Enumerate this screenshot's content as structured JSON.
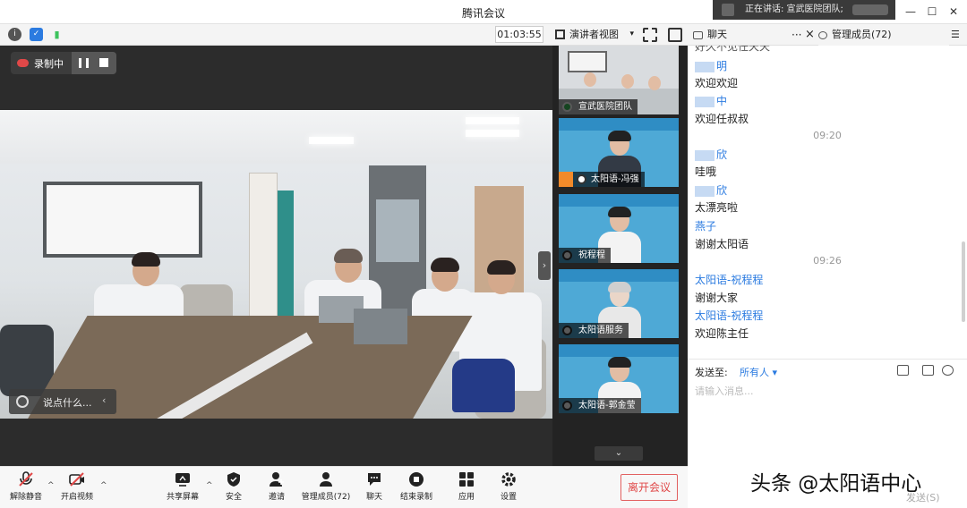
{
  "window": {
    "title": "腾讯会议",
    "speaking_label": "正在讲话: 宣武医院团队;"
  },
  "toolbar": {
    "timer": "01:03:55",
    "view_mode": "演讲者视图"
  },
  "recording": {
    "label": "录制中"
  },
  "stage": {
    "say_something": "说点什么..."
  },
  "thumbnails": [
    {
      "label": "宣武医院团队",
      "mic": "active"
    },
    {
      "label": "太阳语-冯强",
      "mic": "muted"
    },
    {
      "label": "祝程程",
      "mic": "muted"
    },
    {
      "label": "太阳语服务",
      "mic": "muted"
    },
    {
      "label": "太阳语-郭金莹",
      "mic": "muted"
    }
  ],
  "chat_panel": {
    "tab_chat": "聊天",
    "tab_more": "···",
    "tab_close": "×",
    "tab_members": "管理成员(72)",
    "tab_menu": "☰",
    "messages": [
      {
        "name": "",
        "text": "好久不见任天天"
      },
      {
        "name": "明",
        "text": "欢迎欢迎"
      },
      {
        "name": "中",
        "text": "欢迎任叔叔"
      },
      {
        "timestamp": "09:20"
      },
      {
        "name": "欣",
        "text": "哇哦"
      },
      {
        "name": "欣",
        "text": "太漂亮啦"
      },
      {
        "name": "燕子",
        "text": "谢谢太阳语"
      },
      {
        "timestamp": "09:26"
      },
      {
        "name": "太阳语-祝程程",
        "text": "谢谢大家"
      },
      {
        "name": "太阳语-祝程程",
        "text": "欢迎陈主任"
      }
    ],
    "send_to_label": "发送至:",
    "recipient": "所有人 ▾",
    "input_placeholder": "请输入消息...",
    "send_button": "发送(S)"
  },
  "bottom_toolbar": {
    "unmute": "解除静音",
    "start_video": "开启视频",
    "share_screen": "共享屏幕",
    "security": "安全",
    "invite": "邀请",
    "manage_members": "管理成员(72)",
    "chat": "聊天",
    "end_recording": "结束录制",
    "apps": "应用",
    "settings": "设置",
    "leave_meeting": "离开会议"
  },
  "watermark": "头条 @太阳语中心",
  "colors": {
    "accent_blue": "#2b7be0",
    "leave_red": "#e04848",
    "record_red": "#e04848",
    "thumb_blue": "#4ea9d6"
  }
}
